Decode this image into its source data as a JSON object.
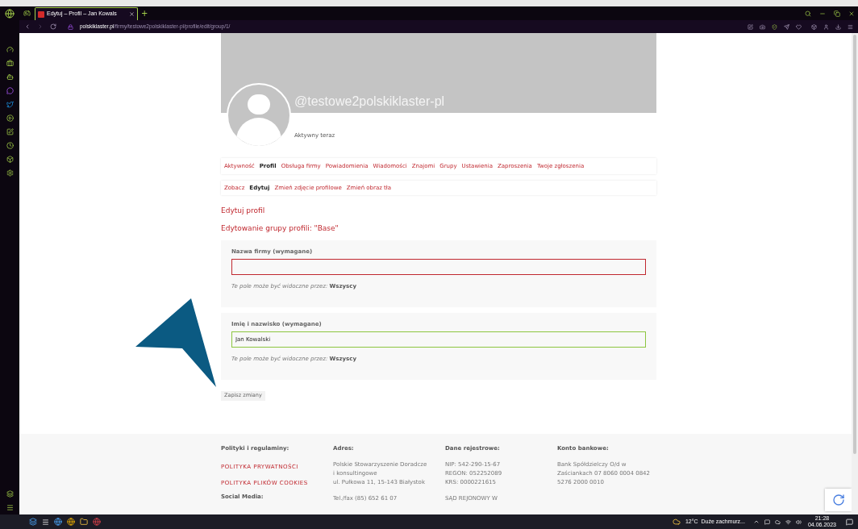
{
  "browser": {
    "tab_title": "Edytuj – Profil – Jan Kowals",
    "new_tab": "+",
    "url_host": "polskiklaster.pl",
    "url_path": "/firmy/testowe2polskiklaster-pl/profile/edit/group/1/"
  },
  "profile": {
    "username": "@testowe2polskiklaster-pl",
    "status": "Aktywny teraz"
  },
  "nav": [
    {
      "label": "Aktywność",
      "selected": false
    },
    {
      "label": "Profil",
      "selected": true
    },
    {
      "label": "Obsługa firmy",
      "selected": false
    },
    {
      "label": "Powiadomienia",
      "selected": false
    },
    {
      "label": "Wiadomości",
      "selected": false
    },
    {
      "label": "Znajomi",
      "selected": false
    },
    {
      "label": "Grupy",
      "selected": false
    },
    {
      "label": "Ustawienia",
      "selected": false
    },
    {
      "label": "Zaproszenia",
      "selected": false
    },
    {
      "label": "Twoje zgłoszenia",
      "selected": false
    }
  ],
  "subnav": [
    {
      "label": "Zobacz",
      "selected": false
    },
    {
      "label": "Edytuj",
      "selected": true
    },
    {
      "label": "Zmień zdjęcie profilowe",
      "selected": false
    },
    {
      "label": "Zmień obraz tła",
      "selected": false
    }
  ],
  "page_title": "Edytuj profil",
  "group_title": "Edytowanie grupy profili: \"Base\"",
  "fields": [
    {
      "label": "Nazwa firmy (wymagane)",
      "invalid": true,
      "visibility_text": "Te pole może być widoczne przez:",
      "visibility": "Wszyscy"
    },
    {
      "label": "Imię i nazwisko (wymagane)",
      "value": "Jan Kowalski",
      "invalid": false,
      "visibility_text": "Te pole może być widoczne przez:",
      "visibility": "Wszyscy"
    }
  ],
  "save_button": "Zapisz zmiany",
  "footer": {
    "columns": [
      {
        "heading": "Polityki i regulaminy:",
        "kind": "links",
        "lines": [
          "POLITYKA PRYWATNOŚCI",
          "POLITYKA PLIKÓW COOKIES"
        ],
        "cut_heading": "Social Media:"
      },
      {
        "heading": "Adres:",
        "kind": "text",
        "lines": [
          "Polskie Stowarzyszenie Doradcze",
          "i konsultingowe",
          "ul. Pułkowa 11, 15-143 Białystok"
        ],
        "cut_heading": "Tel./fax (85) 652 61 07"
      },
      {
        "heading": "Dane rejestrowe:",
        "kind": "text",
        "lines": [
          "NIP: 542-290-15-67",
          "REGON: 052252089",
          "KRS: 0000221615"
        ],
        "cut_heading": "SĄD REJONOWY W"
      },
      {
        "heading": "Konto bankowe:",
        "kind": "text",
        "lines": [
          "Bank Spółdzielczy O/d w",
          "Zaściankach 07 8060 0004 0842",
          "5276 2000 0010"
        ]
      }
    ]
  },
  "taskbar": {
    "weather": "12°C  Duże zachmurz...",
    "time": "21:28",
    "date": "04.06.2023"
  }
}
